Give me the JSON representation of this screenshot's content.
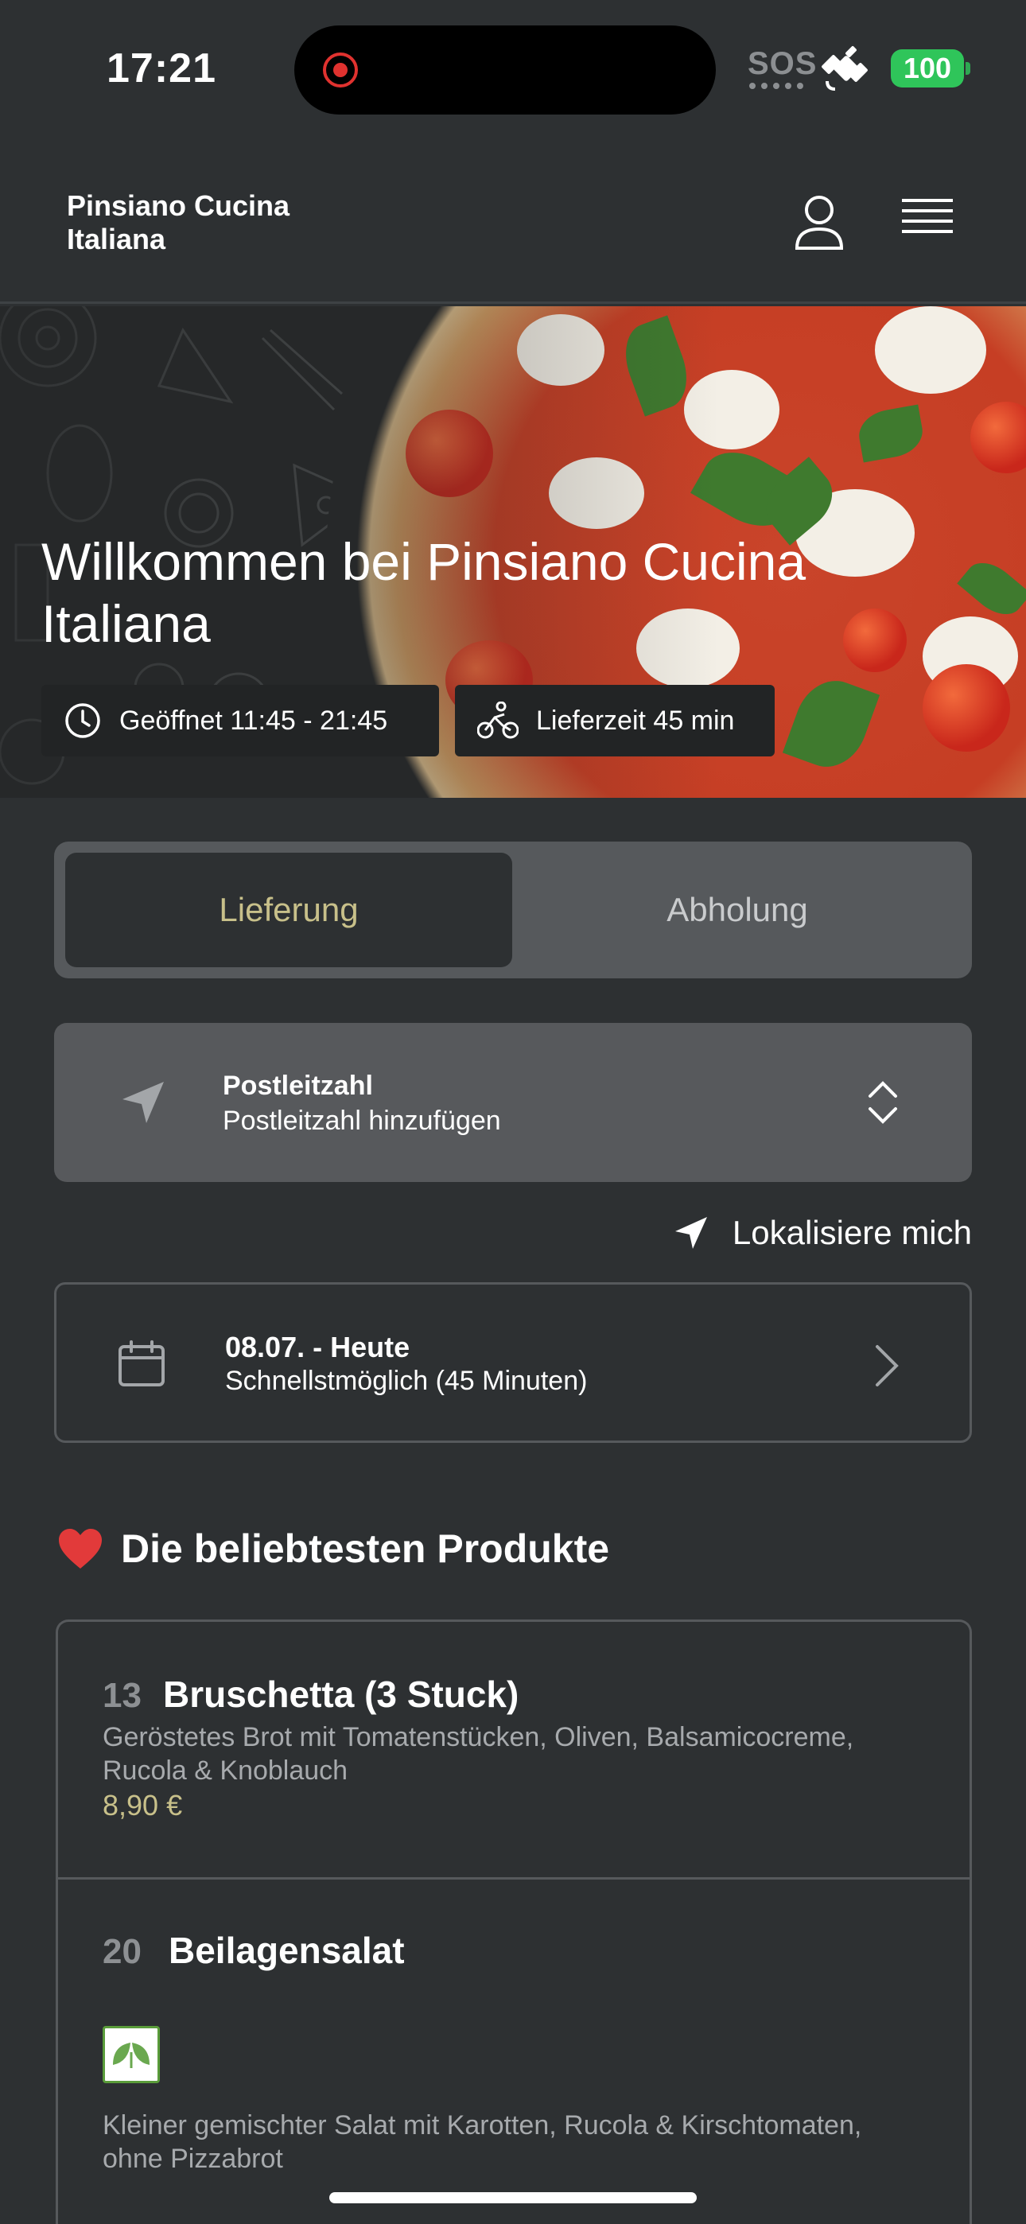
{
  "status_bar": {
    "time": "17:21",
    "sos": "SOS",
    "battery": "100",
    "icons": [
      "recording-icon",
      "satellite-icon",
      "battery-icon"
    ]
  },
  "header": {
    "brand": "Pinsiano Cucina Italiana",
    "icons": [
      "user-icon",
      "menu-icon"
    ]
  },
  "hero": {
    "title": "Willkommen bei Pinsiano Cucina Italiana",
    "opening_hours": "Geöffnet 11:45 - 21:45",
    "delivery_time": "Lieferzeit 45 min",
    "icons": [
      "clock-icon",
      "bicycle-icon"
    ]
  },
  "mode": {
    "delivery": "Lieferung",
    "pickup": "Abholung",
    "selected": "delivery"
  },
  "postcode": {
    "label": "Postleitzahl",
    "placeholder": "Postleitzahl hinzufügen"
  },
  "locate": {
    "label": "Lokalisiere mich"
  },
  "schedule": {
    "date": "08.07. - Heute",
    "time": "Schnellstmöglich (45 Minuten)"
  },
  "popular": {
    "title": "Die beliebtesten Produkte",
    "products": [
      {
        "number": "13",
        "name": "Bruschetta (3 Stuck)",
        "description": "Geröstetes Brot mit Tomatenstücken, Oliven, Balsamicocreme, Rucola & Knoblauch",
        "price": "8,90 €"
      },
      {
        "number": "20",
        "name": "Beilagensalat",
        "description": "Kleiner gemischter Salat mit Karotten, Rucola & Kirschtomaten, ohne Pizzabrot",
        "badge": "vegetarian-icon"
      }
    ]
  },
  "colors": {
    "background": "#2d3032",
    "accent": "#c8c08a",
    "panel": "#56595c",
    "battery": "#2fc55a"
  }
}
